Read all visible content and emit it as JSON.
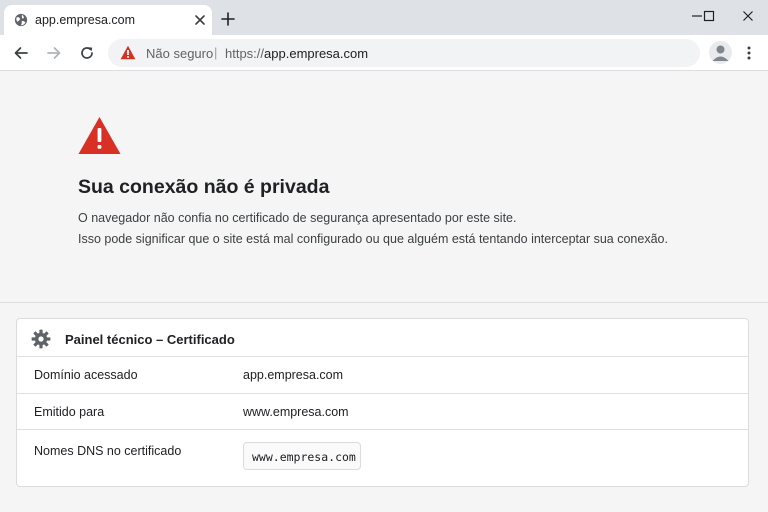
{
  "tab": {
    "title": "app.empresa.com",
    "favicon_icon": "globe-icon",
    "close_icon": "close-icon"
  },
  "new_tab_icon": "plus-icon",
  "window_controls": [
    "minimize-icon",
    "maximize-icon",
    "close-icon"
  ],
  "toolbar": {
    "back_icon": "arrow-left-icon",
    "forward_icon": "arrow-right-icon",
    "reload_icon": "reload-icon",
    "menu_icon": "kebab-menu-icon",
    "profile_icon": "avatar-icon"
  },
  "omnibox": {
    "status_icon": "warning-triangle-icon",
    "status_text": "Não seguro",
    "separator": "|",
    "url_scheme": "https://",
    "url_host": "app.empresa.com"
  },
  "error": {
    "icon": "warning-triangle-icon",
    "title": "Sua conexão não é privada",
    "line1": "O navegador não confia no certificado de segurança apresentado por este site.",
    "line2": "Isso pode significar que o site está mal configurado ou que alguém está tentando interceptar sua conexão."
  },
  "panel": {
    "icon": "gear-icon",
    "title": "Painel técnico – Certificado",
    "rows": [
      {
        "label": "Domínio acessado",
        "value": "app.empresa.com"
      },
      {
        "label": "Emitido para",
        "value": "www.empresa.com"
      },
      {
        "label": "Nomes DNS no certificado",
        "value": "www.empresa.com"
      }
    ]
  },
  "colors": {
    "warning": "#d93025",
    "tabstrip_bg": "#dee1e6",
    "page_bg": "#f5f5f5"
  }
}
